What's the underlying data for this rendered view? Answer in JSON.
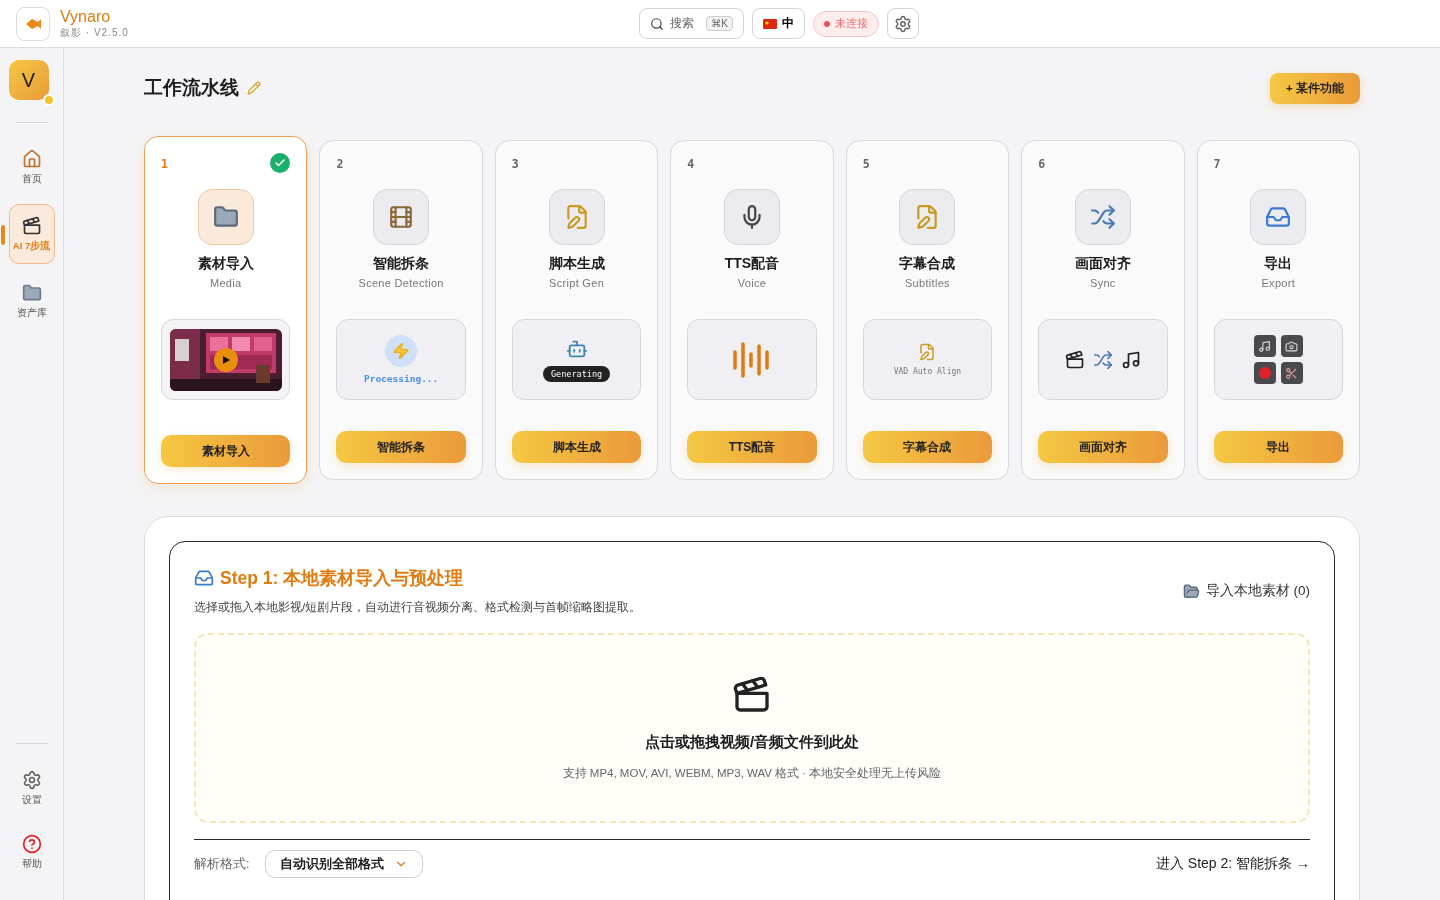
{
  "app": {
    "name": "Vynaro",
    "subtitle": "叙影 · V2.5.0"
  },
  "header": {
    "search": {
      "label": "搜索",
      "shortcut": "⌘K"
    },
    "language": "中",
    "status": {
      "label": "未连接",
      "connected": false
    }
  },
  "sidebar": {
    "avatar": "V",
    "items": [
      {
        "kind": "home",
        "label": "首页",
        "selected": false
      },
      {
        "kind": "workflow",
        "label": "AI 7步流",
        "selected": true
      },
      {
        "kind": "assets",
        "label": "资产库",
        "selected": false
      }
    ],
    "bottom_items": [
      {
        "kind": "settings",
        "label": "设置",
        "selected": false
      },
      {
        "kind": "help",
        "label": "帮助",
        "selected": false
      }
    ]
  },
  "page": {
    "title": "工作流水线",
    "action": "+ 某件功能"
  },
  "steps": [
    {
      "kind": "media",
      "number": "1",
      "title": "素材导入",
      "subtitle": "Media",
      "button": "素材导入",
      "selected": true,
      "done": true,
      "preview": {
        "kind": "video"
      }
    },
    {
      "kind": "scene",
      "number": "2",
      "title": "智能拆条",
      "subtitle": "Scene Detection",
      "button": "智能拆条",
      "selected": false,
      "done": false,
      "preview": {
        "kind": "processing",
        "text": "Processing..."
      }
    },
    {
      "kind": "script",
      "number": "3",
      "title": "脚本生成",
      "subtitle": "Script Gen",
      "button": "脚本生成",
      "selected": false,
      "done": false,
      "preview": {
        "kind": "generating",
        "text": "Generating"
      }
    },
    {
      "kind": "voice",
      "number": "4",
      "title": "TTS配音",
      "subtitle": "Voice",
      "button": "TTS配音",
      "selected": false,
      "done": false,
      "preview": {
        "kind": "waveform"
      }
    },
    {
      "kind": "subtitles",
      "number": "5",
      "title": "字幕合成",
      "subtitle": "Subtitles",
      "button": "字幕合成",
      "selected": false,
      "done": false,
      "preview": {
        "kind": "vad",
        "text": "VAD Auto Align"
      }
    },
    {
      "kind": "sync",
      "number": "6",
      "title": "画面对齐",
      "subtitle": "Sync",
      "button": "画面对齐",
      "selected": false,
      "done": false,
      "preview": {
        "kind": "sync"
      }
    },
    {
      "kind": "export",
      "number": "7",
      "title": "导出",
      "subtitle": "Export",
      "button": "导出",
      "selected": false,
      "done": false,
      "preview": {
        "kind": "export"
      }
    }
  ],
  "step_panel": {
    "title": "Step 1: 本地素材导入与预处理",
    "description": "选择或拖入本地影视/短剧片段，自动进行音视频分离、格式检测与首帧缩略图提取。",
    "import_link": "导入本地素材 (0)",
    "dropzone": {
      "title": "点击或拖拽视频/音频文件到此处",
      "hint": "支持 MP4, MOV, AVI, WEBM, MP3, WAV 格式 · 本地安全处理无上传风险"
    },
    "format_label": "解析格式:",
    "format_value": "自动识别全部格式",
    "next_link": "进入 Step 2: 智能拆条 →"
  }
}
